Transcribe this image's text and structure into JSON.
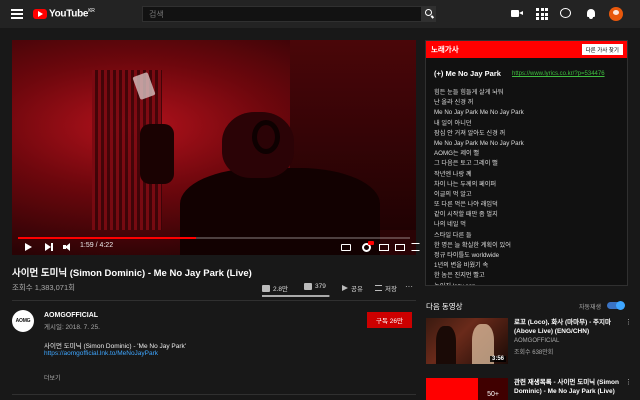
{
  "header": {
    "logo_text": "YouTube",
    "logo_region": "KR",
    "search_placeholder": "검색"
  },
  "player": {
    "time_current": "1:59",
    "time_total": "4:22",
    "time_display": "1:59 / 4:22",
    "progress": 0.455,
    "accent_color": "#ff0000"
  },
  "video": {
    "title": "사이먼 도미닉 (Simon Dominic) - Me No Jay Park (Live)",
    "views": "조회수 1,383,071회",
    "likes": "2.8만",
    "dislikes": "379",
    "share_label": "공유",
    "save_label": "저장",
    "more": "···",
    "like_ratio": 0.99
  },
  "channel": {
    "avatar_text": "AOMG",
    "name": "AOMGOFFICIAL",
    "posted": "게시일: 2018. 7. 25.",
    "subscribe_label": "구독 26만"
  },
  "description": {
    "line1": "사이먼 도미닉 (Simon Dominic) - 'Me No Jay Park'",
    "line2": "https://aomgofficial.lnk.to/MeNoJayPark",
    "more_label": "더보기"
  },
  "lyrics": {
    "header": "노래가사",
    "button": "다른 가사 찾기",
    "song_title": "(+) Me No Jay Park",
    "link": "https://www.lyrics.co.kr/?p=534476",
    "lines": [
      "힘든 눈들 힘들게 살게 놔둬",
      "난 올라 신경 꺼",
      "Me No Jay Park Me No Jay Park",
      "내 일이 아니던",
      "잠심 안 거져 알아도 신경 꺼",
      "Me No Jay Park Me No Jay Park",
      "AOMG는 제이 뻘",
      "그 다음은 토고 그레이 뻘",
      "작년엔 나랑 꼐",
      "차이 나는 두께의 페이퍼",
      "이글의 먹 알고",
      "또 다른 먹은 나야 래임덕",
      "같이 시작할 때만 좀 벌지",
      "나의 네일 먹",
      "스타일 다른 들",
      "한 명은 늘 확실한 계획이 있어",
      "정규 타이틀도 worldwide",
      "1년의 변을 비웠기 속",
      "한 놈은 진지먼 빨고",
      "놀이지 lazy son"
    ]
  },
  "upnext": {
    "title": "다음 동영상",
    "autoplay_label": "자동재생",
    "autoplay_on": true,
    "items": [
      {
        "title": "로꼬 (Loco), 화사 (마마무) - 주지마 (Above Live) (ENG/CHN)",
        "channel": "AOMGOFFICIAL",
        "views": "조회수 638만회",
        "duration": "3:56"
      },
      {
        "title": "관련 재생목록 - 사이먼 도미닉 (Simon Dominic) - Me No Jay Park (Live)",
        "count": "50+"
      }
    ]
  }
}
